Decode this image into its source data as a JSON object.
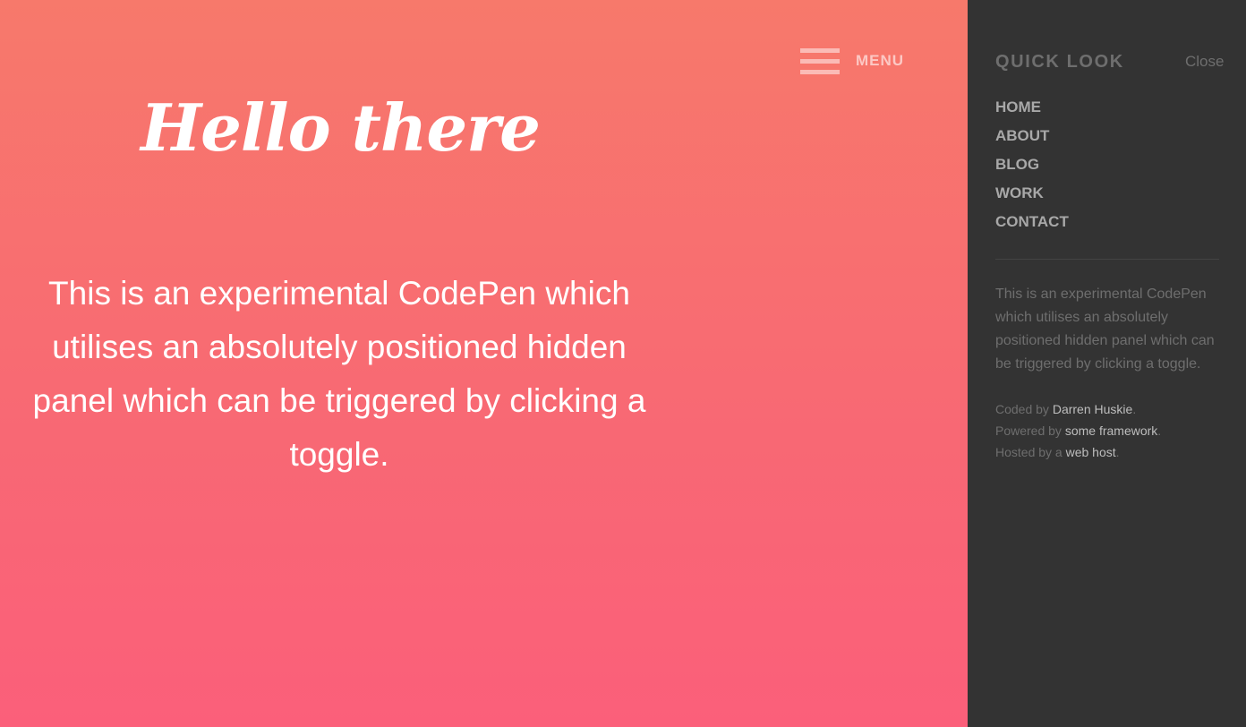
{
  "main": {
    "menu_label": "MENU",
    "heading": "Hello there",
    "intro": "This is an experimental CodePen which utilises an absolutely positioned hidden panel which can be triggered by clicking a toggle."
  },
  "panel": {
    "title": "QUICK LOOK",
    "close_label": "Close",
    "nav": [
      "HOME",
      "ABOUT",
      "BLOG",
      "WORK",
      "CONTACT"
    ],
    "description": "This is an experimental CodePen which utilises an absolutely positioned hidden panel which can be triggered by clicking a toggle.",
    "credits": [
      {
        "prefix": "Coded by ",
        "link": "Darren Huskie",
        "suffix": "."
      },
      {
        "prefix": "Powered by ",
        "link": "some framework",
        "suffix": "."
      },
      {
        "prefix": "Hosted by a ",
        "link": "web host",
        "suffix": "."
      }
    ]
  },
  "colors": {
    "gradient_top": "#f7796b",
    "gradient_bottom": "#fb5f7a",
    "panel_bg": "#333333"
  },
  "icons": {
    "menu": "hamburger-icon"
  }
}
